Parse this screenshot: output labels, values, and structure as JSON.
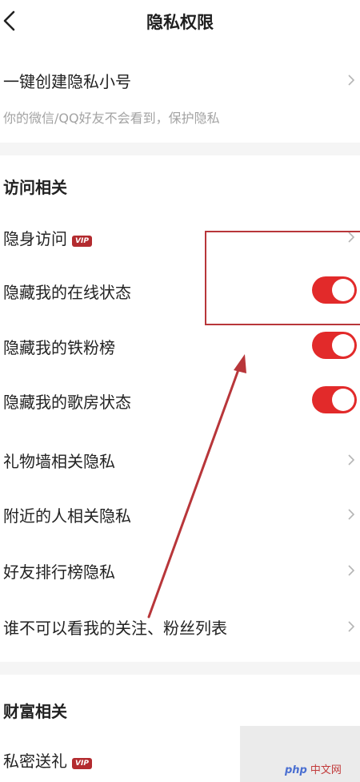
{
  "header": {
    "title": "隐私权限"
  },
  "create_account": {
    "label": "一键创建隐私小号",
    "description": "你的微信/QQ好友不会看到，保护隐私"
  },
  "visit_section": {
    "title": "访问相关",
    "rows": [
      {
        "label": "隐身访问",
        "badge": "VIP",
        "control": "chevron"
      },
      {
        "label": "隐藏我的在线状态",
        "control": "toggle",
        "on": true
      },
      {
        "label": "隐藏我的铁粉榜",
        "control": "toggle",
        "on": true
      },
      {
        "label": "隐藏我的歌房状态",
        "control": "toggle",
        "on": true
      },
      {
        "label": "礼物墙相关隐私",
        "control": "chevron"
      },
      {
        "label": "附近的人相关隐私",
        "control": "chevron"
      },
      {
        "label": "好友排行榜隐私",
        "control": "chevron"
      },
      {
        "label": "谁不可以看我的关注、粉丝列表",
        "control": "chevron"
      }
    ]
  },
  "wealth_section": {
    "title": "财富相关",
    "rows": [
      {
        "label": "私密送礼",
        "badge": "VIP"
      }
    ]
  },
  "watermark": {
    "php": "php",
    "cn": "中文网"
  },
  "colors": {
    "toggle_on": "#e22a2a",
    "vip_badge": "#b32b2f",
    "annotation": "#b8363a"
  }
}
